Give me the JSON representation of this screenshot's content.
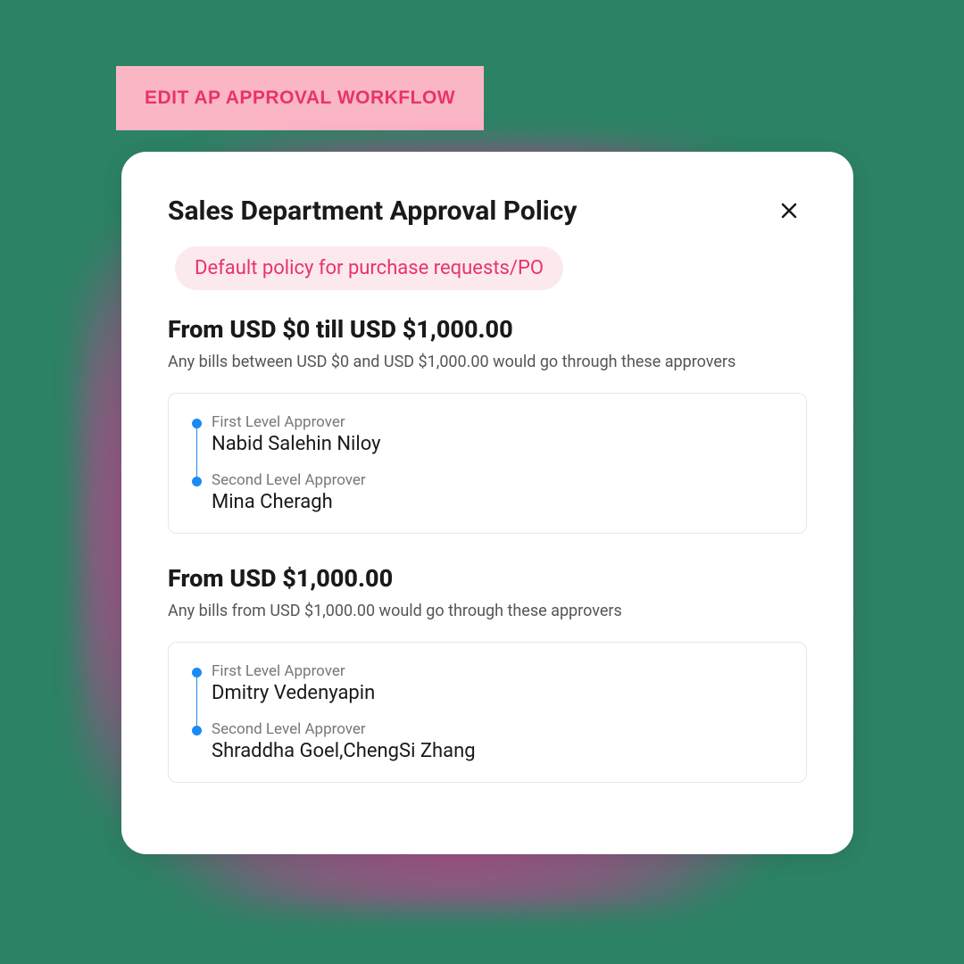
{
  "topButton": {
    "label": "EDIT AP APPROVAL WORKFLOW"
  },
  "card": {
    "title": "Sales Department Approval Policy",
    "badge": "Default policy for purchase requests/PO",
    "tiers": [
      {
        "title": "From USD $0 till USD $1,000.00",
        "description": "Any bills between USD $0 and USD $1,000.00 would go through these approvers",
        "approvers": [
          {
            "label": "First Level Approver",
            "name": "Nabid Salehin Niloy"
          },
          {
            "label": "Second Level Approver",
            "name": "Mina Cheragh"
          }
        ]
      },
      {
        "title": "From USD $1,000.00",
        "description": "Any bills from USD $1,000.00 would go through these approvers",
        "approvers": [
          {
            "label": "First Level Approver",
            "name": "Dmitry Vedenyapin"
          },
          {
            "label": "Second Level Approver",
            "name": "Shraddha Goel,ChengSi Zhang"
          }
        ]
      }
    ]
  }
}
